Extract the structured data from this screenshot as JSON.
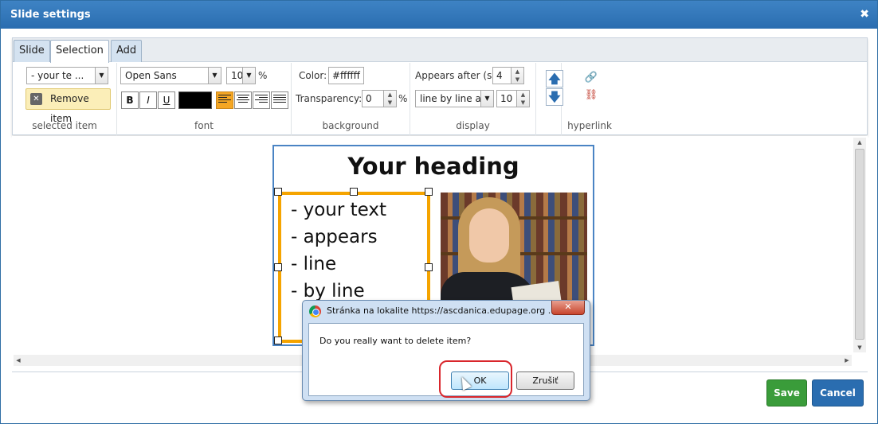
{
  "window": {
    "title": "Slide settings",
    "close_glyph": "✖"
  },
  "tabs": [
    {
      "label": "Slide"
    },
    {
      "label": "Selection"
    },
    {
      "label": "Add"
    }
  ],
  "selected_item": {
    "value": "- your te ...",
    "remove_label": "Remove item",
    "group_label": "selected item"
  },
  "font": {
    "family": "Open Sans",
    "size": "10",
    "unit": "%",
    "bold": "B",
    "italic": "I",
    "underline": "U",
    "color": "#000000",
    "group_label": "font"
  },
  "background": {
    "color_label": "Color:",
    "color_value": "#ffffff",
    "transparency_label": "Transparency:",
    "transparency_value": "0",
    "transparency_unit": "%",
    "group_label": "background"
  },
  "display": {
    "appears_label": "Appears after (s):",
    "appears_value": "4",
    "mode_value": "line by line ap",
    "mode_number": "10",
    "group_label": "display"
  },
  "hyperlink": {
    "group_label": "hyperlink"
  },
  "slide": {
    "heading": "Your heading",
    "lines": [
      "- your text",
      "- appears",
      "- line",
      "- by line"
    ]
  },
  "alert": {
    "title": "Stránka na lokalite https://ascdanica.edupage.org ...",
    "message": "Do you really want to delete item?",
    "ok_label": "OK",
    "cancel_label": "Zrušiť"
  },
  "footer": {
    "save_label": "Save",
    "cancel_label": "Cancel"
  },
  "colors": {
    "accent": "#2a6db0",
    "save": "#3a9c3a",
    "selection_border": "#f5a400",
    "highlight": "#d9262c"
  }
}
